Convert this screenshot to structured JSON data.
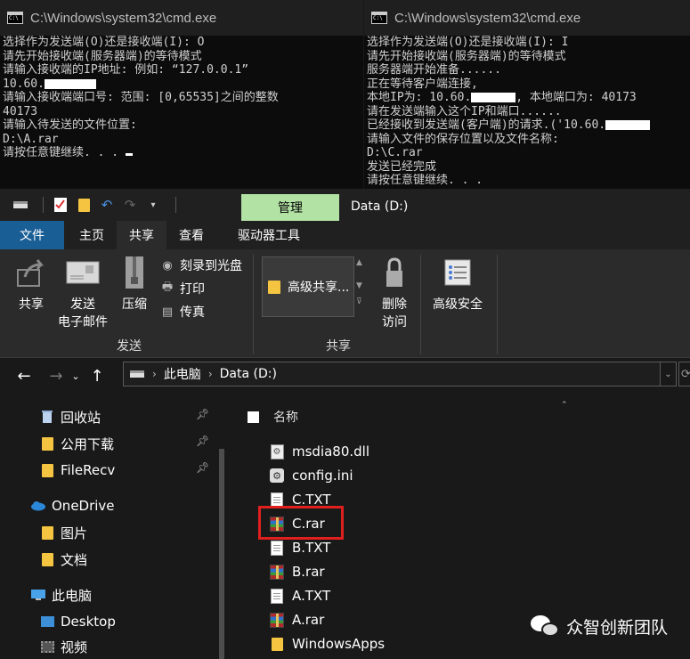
{
  "cmd_left": {
    "title": "C:\\Windows\\system32\\cmd.exe",
    "lines": [
      "选择作为发送端(O)还是接收端(I): O",
      "请先开始接收端(服务器端)的等待模式",
      "请输入接收端的IP地址: 例如: “127.0.0.1”",
      "10.60.",
      "请输入接收端端口号: 范围: [0,65535]之间的整数",
      "40173",
      "请输入待发送的文件位置:",
      "D:\\A.rar",
      "请按任意键继续. . ."
    ]
  },
  "cmd_right": {
    "title": "C:\\Windows\\system32\\cmd.exe",
    "lines": [
      "选择作为发送端(O)还是接收端(I): I",
      "请先开始接收端(服务器端)的等待模式",
      "服务器端开始准备......",
      "正在等待客户端连接,",
      "本地IP为: 10.60.",
      ", 本地端口为: 40173",
      "请在发送端输入这个IP和端口......",
      "已经接收到发送端(客户端)的请求.('10.60.",
      "请输入文件的保存位置以及文件名称:",
      "D:\\C.rar",
      "发送已经完成",
      "请按任意键继续. . ."
    ]
  },
  "explorer": {
    "manage_tab": "管理",
    "window_title": "Data (D:)",
    "tabs": [
      "文件",
      "主页",
      "共享",
      "查看",
      "驱动器工具"
    ],
    "ribbon": {
      "share": "共享",
      "email_line1": "发送",
      "email_line2": "电子邮件",
      "zip": "压缩",
      "burn": "刻录到光盘",
      "print": "打印",
      "fax": "传真",
      "group_send": "发送",
      "advanced_share": "高级共享...",
      "remove_access_line1": "删除",
      "remove_access_line2": "访问",
      "advanced_security": "高级安全",
      "group_share": "共享"
    },
    "address": {
      "crumb1": "此电脑",
      "crumb2": "Data (D:)"
    },
    "nav": {
      "recycle": "回收站",
      "public_downloads": "公用下载",
      "filerecv": "FileRecv",
      "onedrive": "OneDrive",
      "pictures": "图片",
      "documents": "文档",
      "this_pc": "此电脑",
      "desktop": "Desktop",
      "videos": "视频"
    },
    "column_name": "名称",
    "files": [
      {
        "name": "msdia80.dll",
        "icon": "dll-icon"
      },
      {
        "name": "config.ini",
        "icon": "ini-icon"
      },
      {
        "name": "C.TXT",
        "icon": "text-file-icon"
      },
      {
        "name": "C.rar",
        "icon": "rar-archive-icon"
      },
      {
        "name": "B.TXT",
        "icon": "text-file-icon"
      },
      {
        "name": "B.rar",
        "icon": "rar-archive-icon"
      },
      {
        "name": "A.TXT",
        "icon": "text-file-icon"
      },
      {
        "name": "A.rar",
        "icon": "rar-archive-icon"
      },
      {
        "name": "WindowsApps",
        "icon": "folder-icon"
      }
    ]
  },
  "watermark": "众智创新团队",
  "colors": {
    "file_tab": "#1a5e96",
    "manage_tab": "#b3e2a5",
    "highlight": "#e0201e",
    "folder": "#f5c542"
  }
}
